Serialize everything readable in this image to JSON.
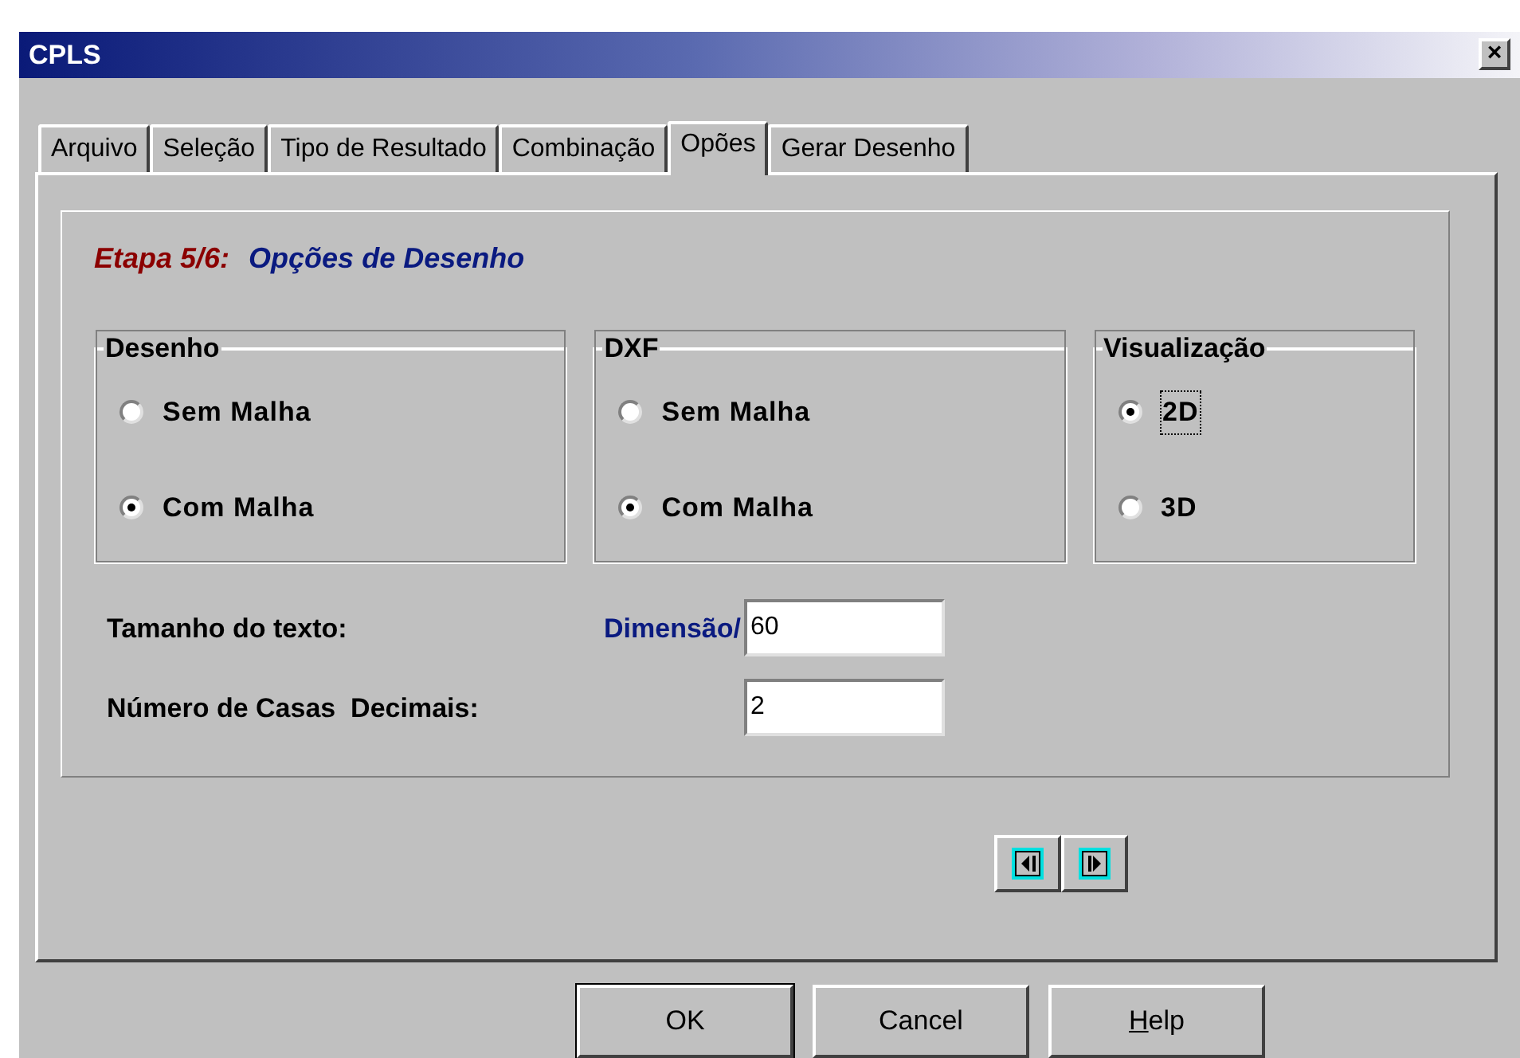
{
  "window": {
    "title": "CPLS",
    "close": "×"
  },
  "tabs": [
    {
      "label": "Arquivo",
      "selected": false
    },
    {
      "label": "Seleção",
      "selected": false
    },
    {
      "label": "Tipo de Resultado",
      "selected": false
    },
    {
      "label": "Combinação",
      "selected": false
    },
    {
      "label": "Opões",
      "selected": true
    },
    {
      "label": "Gerar Desenho",
      "selected": false
    }
  ],
  "step": {
    "label": "Etapa 5/6:",
    "title": "Opções de Desenho"
  },
  "groups": [
    {
      "title": "Desenho",
      "options": [
        {
          "label": "Sem Malha",
          "selected": false,
          "focused": false
        },
        {
          "label": "Com Malha",
          "selected": true,
          "focused": false
        }
      ]
    },
    {
      "title": "DXF",
      "options": [
        {
          "label": "Sem Malha",
          "selected": false,
          "focused": false
        },
        {
          "label": "Com Malha",
          "selected": true,
          "focused": false
        }
      ]
    },
    {
      "title": "Visualização",
      "options": [
        {
          "label": "2D",
          "selected": true,
          "focused": true
        },
        {
          "label": "3D",
          "selected": false,
          "focused": false
        }
      ]
    }
  ],
  "fields": [
    {
      "label": "Tamanho do texto:",
      "note": "Dimensão/",
      "value": "60"
    },
    {
      "label": "Número de Casas  Decimais:",
      "value": "2"
    }
  ],
  "nav": [
    {
      "kind": "prev"
    },
    {
      "kind": "next"
    }
  ],
  "buttons": [
    {
      "label": "OK",
      "default": true,
      "underline_first": false
    },
    {
      "label": "Cancel",
      "default": false,
      "underline_first": false
    },
    {
      "label": "Help",
      "default": false,
      "underline_first": true
    }
  ]
}
